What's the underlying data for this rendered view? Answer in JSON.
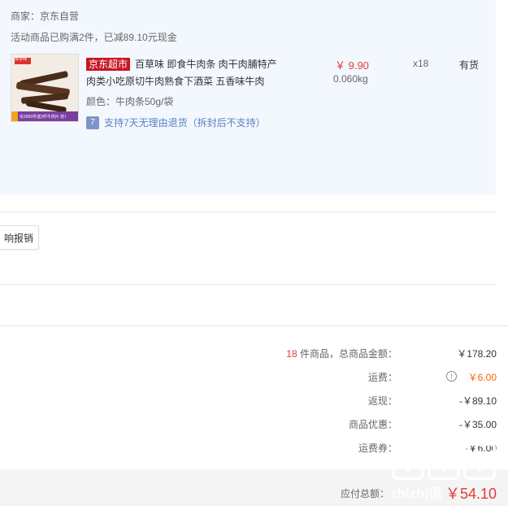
{
  "shop": {
    "seller": "商家：京东自营",
    "promotion": "活动商品已购满2件，已减89.10元现金"
  },
  "item": {
    "badge": "京东超市",
    "title": "百草味 即食牛肉条 肉干肉脯特产肉类小吃原切牛肉熟食下酒菜 五香味牛肉",
    "spec": "颜色：牛肉条50g/袋",
    "service_icon": "7",
    "service": "支持7天无理由退货（拆封后不支持）",
    "price": "￥ 9.90",
    "weight": "0.060kg",
    "quantity": "x18",
    "stock": "有货",
    "image_brand": "百草味",
    "image_banner": "买2000件送3件牛肉片 抢！"
  },
  "reimburse_button": "响报销",
  "summary": {
    "count": "18",
    "count_suffix": "件商品，总商品金额：",
    "subtotal": "￥178.20",
    "shipping_label": "运费：",
    "shipping": "￥6.00",
    "cashback_label": "返现：",
    "cashback": "-￥89.10",
    "discount_label": "商品优惠：",
    "discount": "-￥35.00",
    "coupon_label": "运费券：",
    "coupon": "-￥6.00",
    "total_label": "应付总额：",
    "total": "￥54.10"
  },
  "watermark": "zhizhi值"
}
